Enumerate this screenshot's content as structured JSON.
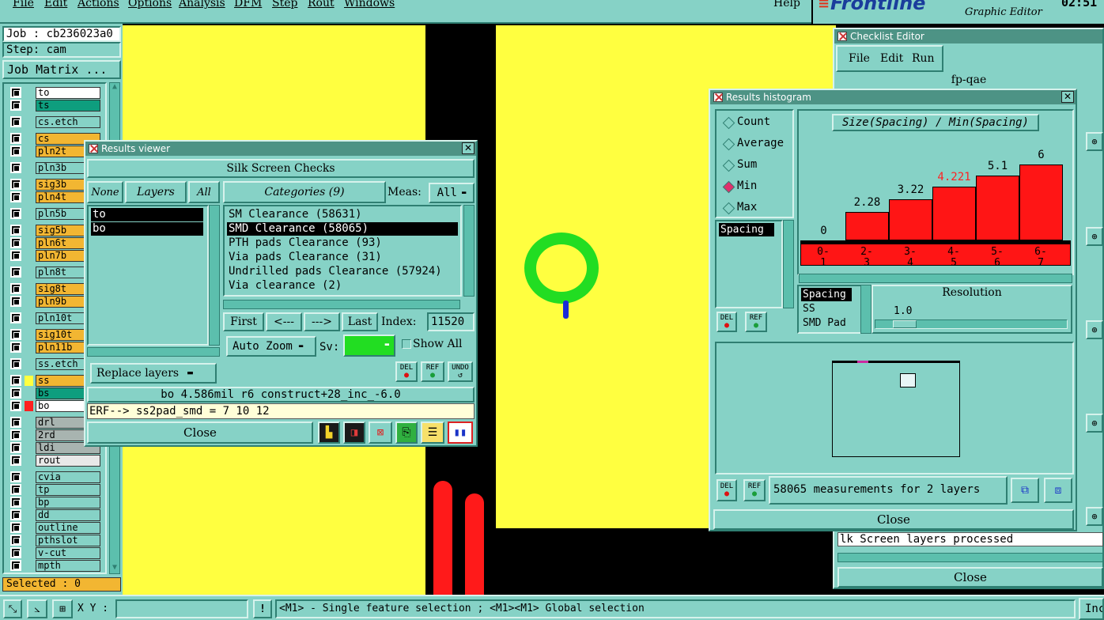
{
  "menubar": {
    "items": [
      "File",
      "Edit",
      "Actions",
      "Options",
      "Analysis",
      "DFM",
      "Step",
      "Rout",
      "Windows"
    ],
    "help": "Help",
    "brand": "Frontline",
    "app_title": "Graphic Editor",
    "clock": "02:51"
  },
  "left_panel": {
    "job_line": "Job : cb236023a0",
    "step_line": "Step: cam",
    "job_matrix_button": "Job Matrix ...",
    "layers": [
      {
        "name": "to",
        "color": "#ffffff"
      },
      {
        "name": "ts",
        "color": "#0e9e7e"
      },
      {
        "name": "cs.etch",
        "color": "#86d2c6"
      },
      {
        "name": "cs",
        "color": "#f2b632"
      },
      {
        "name": "pln2t",
        "color": "#f2b632"
      },
      {
        "name": "pln3b",
        "color": "#86d2c6"
      },
      {
        "name": "sig3b",
        "color": "#f2b632"
      },
      {
        "name": "pln4t",
        "color": "#f2b632"
      },
      {
        "name": "pln5b",
        "color": "#86d2c6"
      },
      {
        "name": "sig5b",
        "color": "#f2b632"
      },
      {
        "name": "pln6t",
        "color": "#f2b632"
      },
      {
        "name": "pln7b",
        "color": "#f2b632"
      },
      {
        "name": "pln8t",
        "color": "#86d2c6"
      },
      {
        "name": "sig8t",
        "color": "#f2b632"
      },
      {
        "name": "pln9b",
        "color": "#f2b632"
      },
      {
        "name": "pln10t",
        "color": "#86d2c6"
      },
      {
        "name": "sig10t",
        "color": "#f2b632"
      },
      {
        "name": "pln11b",
        "color": "#f2b632"
      },
      {
        "name": "ss.etch",
        "color": "#86d2c6"
      },
      {
        "name": "ss",
        "color": "#f2b632"
      },
      {
        "name": "bs",
        "color": "#0e9e7e"
      },
      {
        "name": "bo",
        "color": "#ffffff"
      },
      {
        "name": "drl",
        "color": "#a8b4b0"
      },
      {
        "name": "2rd",
        "color": "#a8b4b0"
      },
      {
        "name": "ldi",
        "color": "#a8b4b0"
      },
      {
        "name": "rout",
        "color": "#e8e8e8"
      },
      {
        "name": "cvia",
        "color": "#86d2c6"
      },
      {
        "name": "tp",
        "color": "#86d2c6"
      },
      {
        "name": "bp",
        "color": "#86d2c6"
      },
      {
        "name": "dd",
        "color": "#86d2c6"
      },
      {
        "name": "outline",
        "color": "#86d2c6"
      },
      {
        "name": "pthslot",
        "color": "#86d2c6"
      },
      {
        "name": "v-cut",
        "color": "#86d2c6"
      },
      {
        "name": "mpth",
        "color": "#86d2c6"
      }
    ],
    "selected": "Selected : 0"
  },
  "results_viewer": {
    "title": "Results viewer",
    "header": "Silk Screen Checks",
    "none_btn": "None",
    "layers_btn": "Layers",
    "all_btn": "All",
    "layer_list": [
      "to",
      "bo"
    ],
    "categories_btn": "Categories (9)",
    "meas_label": "Meas:",
    "meas_value": "All",
    "categories": [
      "SM Clearance (58631)",
      "SMD Clearance (58065)",
      "PTH pads Clearance (93)",
      "Via pads Clearance (31)",
      "Undrilled pads Clearance (57924)",
      "Via clearance (2)"
    ],
    "selected_category": 1,
    "first_btn": "First",
    "prev_btn": "<---",
    "next_btn": "--->",
    "last_btn": "Last",
    "index_label": "Index:",
    "index_value": "11520",
    "auto_zoom": "Auto Zoom",
    "sv_label": "Sv:",
    "show_all": "Show All",
    "replace_layers": "Replace layers",
    "del_label": "DEL",
    "ref_label": "REF",
    "undo_label": "UNDO",
    "info_line": "bo 4.586mil  r6  construct+28_inc_-6.0",
    "erf_line": "ERF--> ss2pad_smd = 7 10 12",
    "close_btn": "Close"
  },
  "histogram": {
    "title": "Results histogram",
    "modes": [
      "Count",
      "Average",
      "Sum",
      "Min",
      "Max"
    ],
    "active_mode": "Min",
    "chart_title": "Size(Spacing) / Min(Spacing)",
    "list_item": "Spacing",
    "del_label": "DEL",
    "ref_label": "REF",
    "measure_list": [
      "Spacing",
      "SS",
      "SMD Pad"
    ],
    "resolution_label": "Resolution",
    "resolution_value": "1.0",
    "status": "58065 measurements for 2 layers",
    "close_btn": "Close"
  },
  "chart_data": {
    "type": "bar",
    "title": "Size(Spacing) / Min(Spacing)",
    "categories": [
      "0-1",
      "2-3",
      "3-4",
      "4-5",
      "5-6",
      "6-7"
    ],
    "values": [
      0,
      2.28,
      3.22,
      4.221,
      5.1,
      6
    ],
    "labels": [
      "0",
      "2.28",
      "3.22",
      "4.221",
      "5.1",
      "6"
    ],
    "highlight_index": 3,
    "highlight_color": "#ff2222",
    "bar_color": "#ff1515",
    "ylim": [
      0,
      6
    ]
  },
  "checklist": {
    "title": "Checklist Editor",
    "menu": [
      "File",
      "Edit",
      "Run"
    ],
    "name": "fp-qae",
    "status_line": "lk Screen layers processed",
    "close_btn": "Close"
  },
  "statusbar": {
    "xy_label": "X Y :",
    "hint": "<M1> - Single feature selection ; <M1><M1> Global selection",
    "right_btn": "Inc"
  },
  "colors": {
    "ui_teal": "#86d2c6",
    "canvas_yellow": "#ffff40",
    "canvas_black": "#000000",
    "pad_green": "#22dd22",
    "trace_red": "#ff1a1a"
  }
}
